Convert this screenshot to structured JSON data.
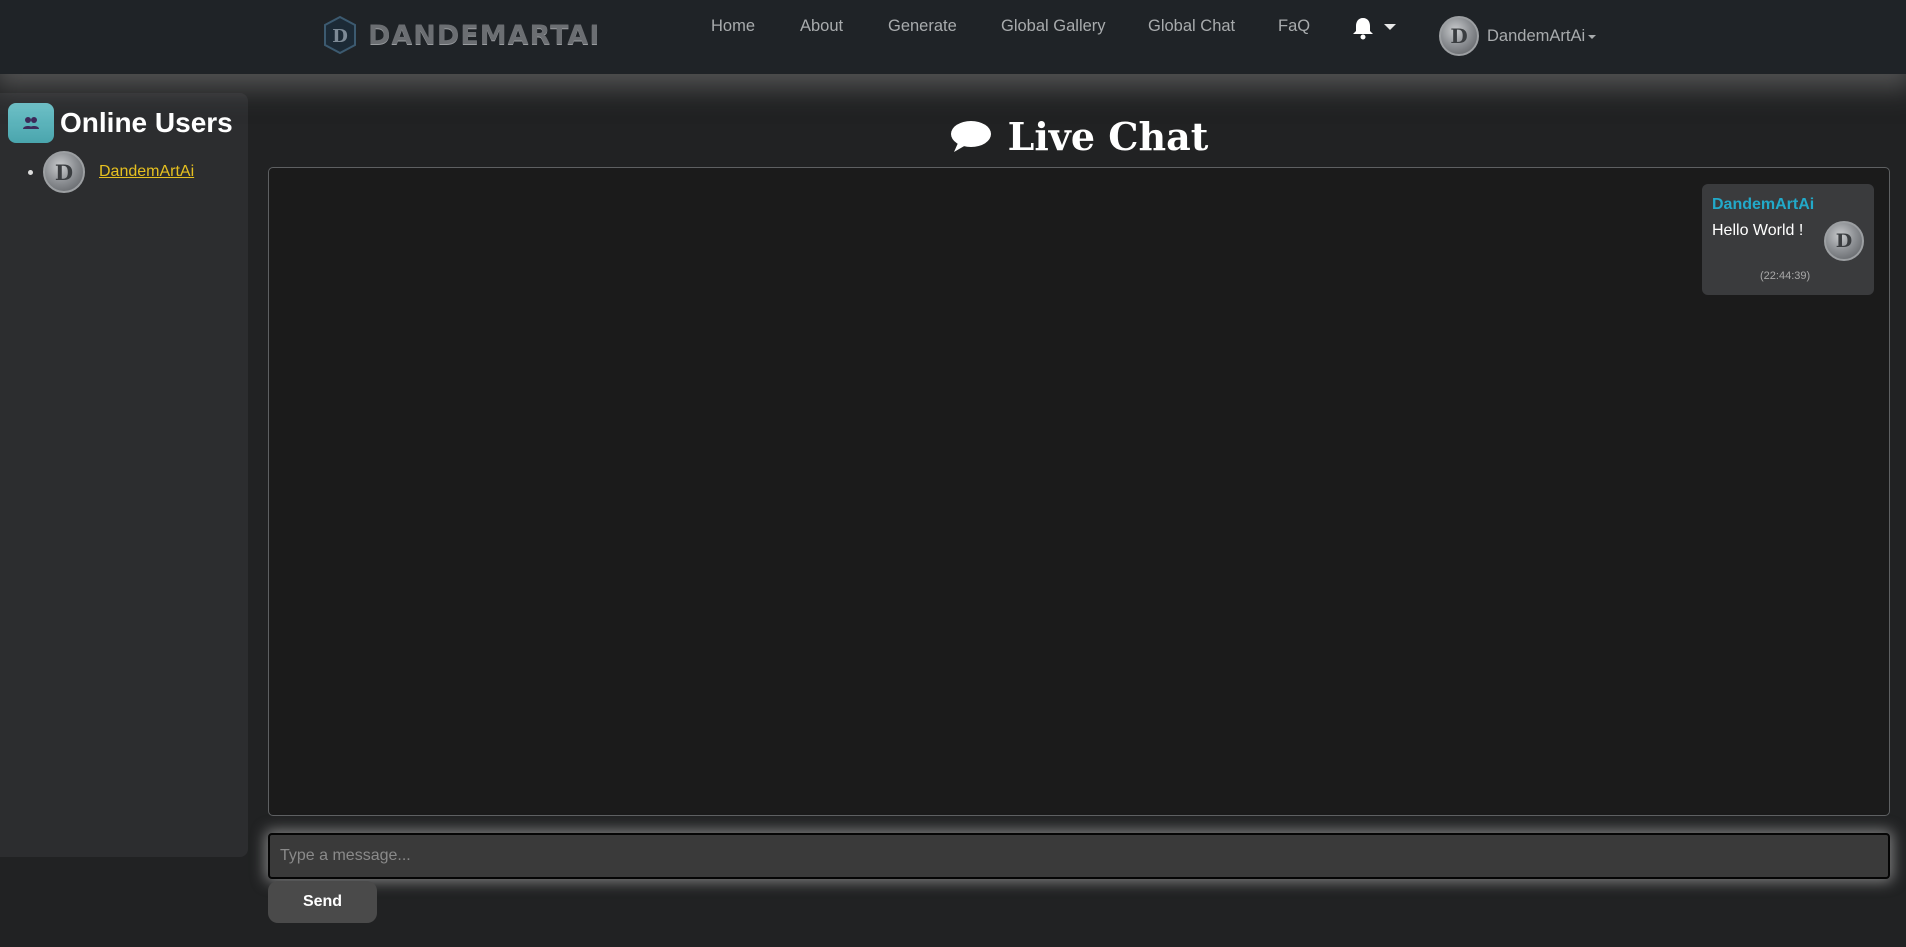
{
  "navbar": {
    "brand": "DANDEMARTAI",
    "links": [
      "Home",
      "About",
      "Generate",
      "Global Gallery",
      "Global Chat",
      "FaQ"
    ],
    "user_name": "DandemArtAi"
  },
  "sidebar": {
    "title": "Online Users",
    "users": [
      {
        "name": "DandemArtAi"
      }
    ]
  },
  "chat": {
    "title": "Live Chat",
    "messages": [
      {
        "user": "DandemArtAi",
        "text": "Hello World !",
        "time": "(22:44:39)"
      }
    ],
    "input_placeholder": "Type a message...",
    "send_label": "Send"
  },
  "colors": {
    "accent_username": "#22a9c9",
    "online_user_link": "#e6c020",
    "sidebar_icon": "#5bb4bb"
  }
}
